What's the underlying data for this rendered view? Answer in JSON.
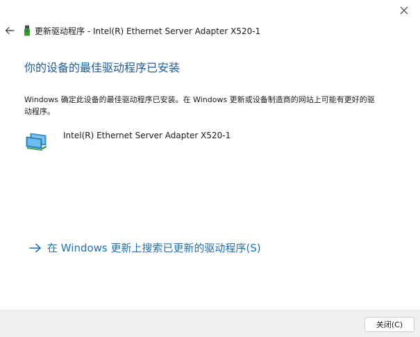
{
  "window": {
    "title": "更新驱动程序 - Intel(R) Ethernet Server Adapter X520-1"
  },
  "heading": "你的设备的最佳驱动程序已安装",
  "description": "Windows 确定此设备的最佳驱动程序已安装。在 Windows 更新或设备制造商的网站上可能有更好的驱动程序。",
  "device": {
    "name": "Intel(R) Ethernet Server Adapter X520-1",
    "icon": "network-adapter-icon"
  },
  "search_link": {
    "label": "在 Windows 更新上搜索已更新的驱动程序(S)"
  },
  "footer": {
    "close_label": "关闭(C)"
  },
  "colors": {
    "heading": "#1e5b9a",
    "link": "#1e6fb5",
    "footer_bg": "#f0f0f0"
  }
}
